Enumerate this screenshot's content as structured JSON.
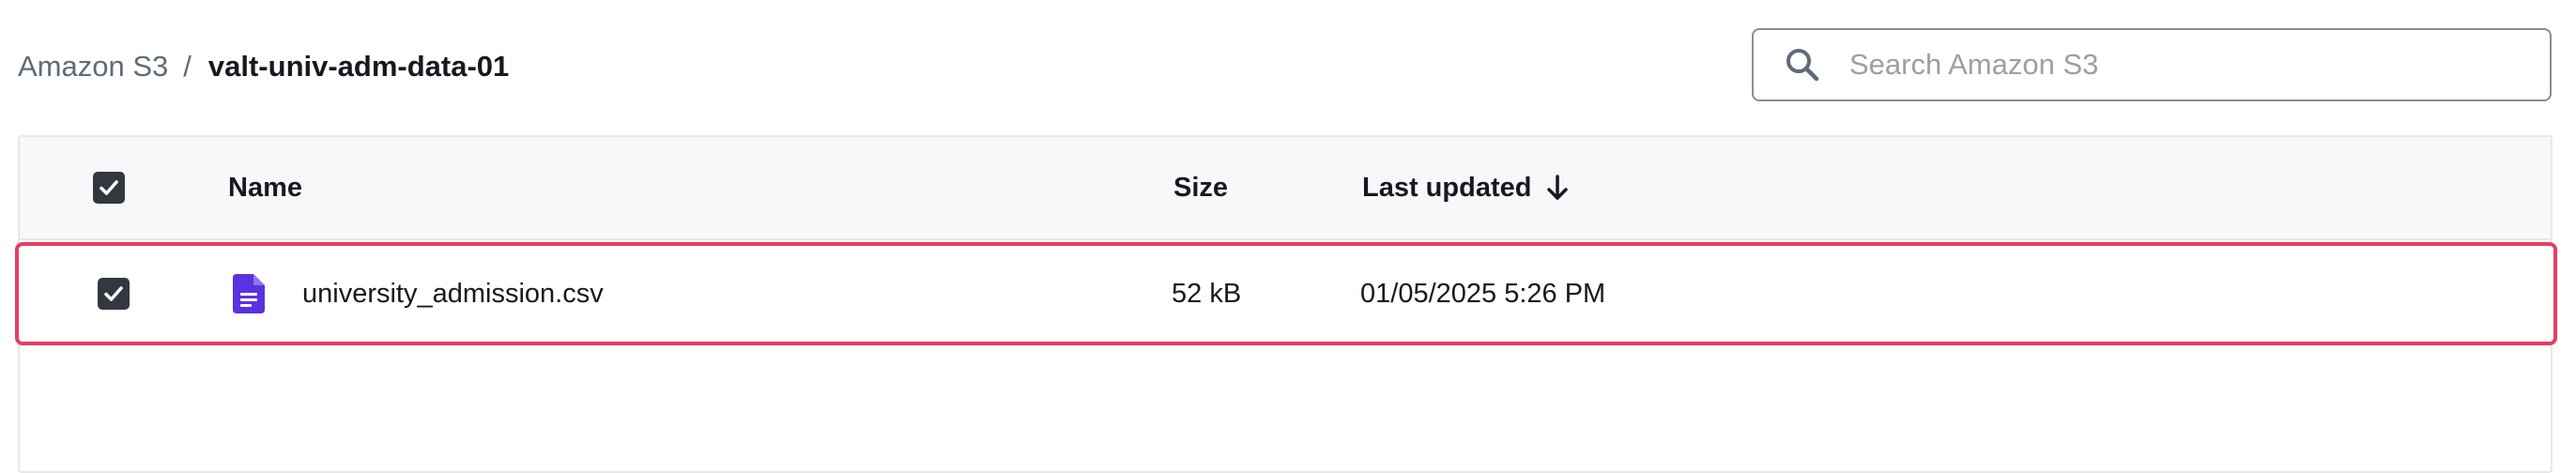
{
  "breadcrumb": {
    "root": "Amazon S3",
    "separator": "/",
    "current": "valt-univ-adm-data-01"
  },
  "search": {
    "placeholder": "Search Amazon S3",
    "value": ""
  },
  "table": {
    "columns": {
      "name": "Name",
      "size": "Size",
      "last_updated": "Last updated"
    },
    "sort": {
      "column": "last_updated",
      "direction": "descending"
    },
    "select_all_checked": true,
    "rows": [
      {
        "selected": true,
        "icon": "file-document-icon",
        "name": "university_admission.csv",
        "size": "52 kB",
        "last_updated": "01/05/2025 5:26 PM"
      }
    ]
  },
  "colors": {
    "checkbox_fill": "#333840",
    "file_icon": "#5a32e0",
    "selection_outline": "#e33e63",
    "header_background": "#f8f8fa"
  }
}
